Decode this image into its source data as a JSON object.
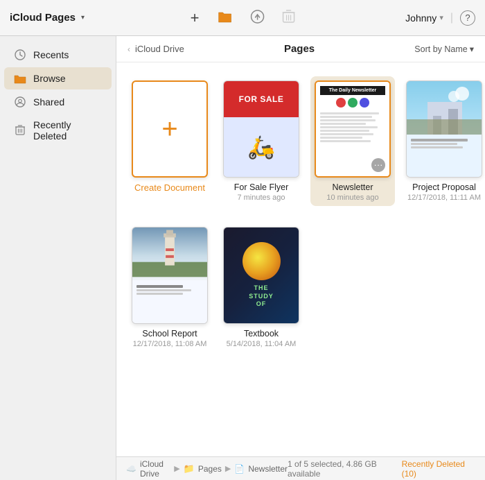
{
  "app": {
    "title": "iCloud Pages",
    "title_dropdown_label": "iCloud Pages"
  },
  "toolbar": {
    "add_label": "+",
    "browse_icon": "browse",
    "upload_icon": "upload",
    "trash_icon": "trash",
    "user_label": "Johnny",
    "help_label": "?"
  },
  "sidebar": {
    "items": [
      {
        "id": "recents",
        "label": "Recents",
        "icon": "clock"
      },
      {
        "id": "browse",
        "label": "Browse",
        "icon": "folder",
        "active": true
      },
      {
        "id": "shared",
        "label": "Shared",
        "icon": "person-circle"
      },
      {
        "id": "recently-deleted",
        "label": "Recently Deleted",
        "icon": "trash"
      }
    ]
  },
  "content": {
    "breadcrumb_back": "< iCloud Drive",
    "current_folder": "Pages",
    "sort_label": "Sort by Name",
    "sort_arrow": "▾"
  },
  "documents": [
    {
      "id": "create-new",
      "type": "create",
      "name": "Create Document",
      "date": ""
    },
    {
      "id": "for-sale-flyer",
      "type": "for-sale",
      "name": "For Sale Flyer",
      "date": "7 minutes ago"
    },
    {
      "id": "newsletter",
      "type": "newsletter",
      "name": "Newsletter",
      "date": "10 minutes ago",
      "selected": true
    },
    {
      "id": "project-proposal",
      "type": "project",
      "name": "Project Proposal",
      "date": "12/17/2018, 11:11 AM"
    },
    {
      "id": "school-report",
      "type": "school-report",
      "name": "School Report",
      "date": "12/17/2018, 11:08 AM"
    },
    {
      "id": "textbook",
      "type": "textbook",
      "name": "Textbook",
      "date": "5/14/2018, 11:04 AM"
    }
  ],
  "status_bar": {
    "cloud_label": "iCloud Drive",
    "pages_label": "Pages",
    "newsletter_label": "Newsletter",
    "selection_info": "1 of 5 selected, 4.86 GB available",
    "recently_deleted_label": "Recently Deleted (10)"
  }
}
